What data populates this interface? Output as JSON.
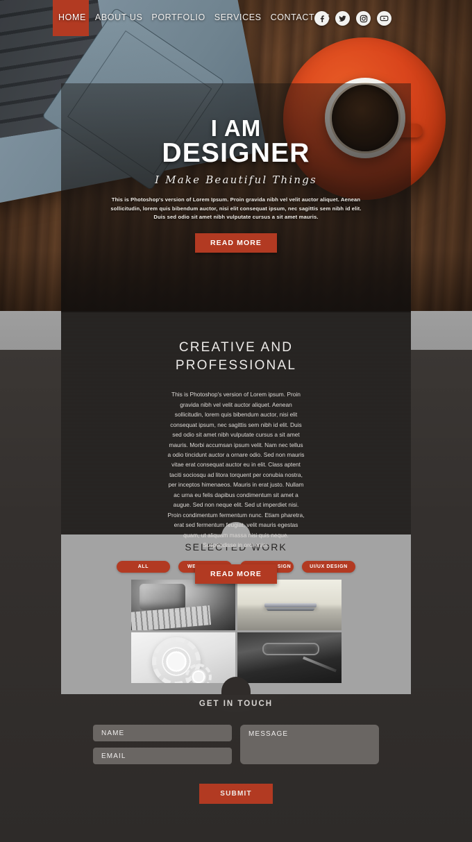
{
  "nav": {
    "items": [
      {
        "label": "HOME",
        "active": true
      },
      {
        "label": "ABOUT US",
        "active": false
      },
      {
        "label": "PORTFOLIO",
        "active": false
      },
      {
        "label": "SERVICES",
        "active": false
      },
      {
        "label": "CONTACT US",
        "active": false
      }
    ],
    "socials": [
      {
        "name": "facebook-icon"
      },
      {
        "name": "twitter-icon"
      },
      {
        "name": "instagram-icon"
      },
      {
        "name": "youtube-icon"
      }
    ]
  },
  "hero": {
    "title_line1": "I AM",
    "title_line2": "DESIGNER",
    "tagline": "I Make Beautiful Things",
    "paragraph": "This is Photoshop's version  of Lorem Ipsum. Proin gravida nibh vel velit auctor aliquet. Aenean sollicitudin, lorem quis bibendum auctor, nisi elit consequat ipsum, nec sagittis sem nibh id elit. Duis sed odio sit amet nibh vulputate cursus a sit amet mauris.",
    "cta": "READ MORE"
  },
  "about": {
    "title_line1": "CREATIVE AND",
    "title_line2": "PROFESSIONAL",
    "paragraph": "This is Photoshop's version  of Lorem ipsum. Proin gravida nibh vel velit auctor aliquet. Aenean sollicitudin, lorem quis bibendum auctor, nisi elit consequat ipsum, nec sagittis sem nibh id elit. Duis sed odio sit amet nibh vulputate cursus a sit amet mauris. Morbi accumsan ipsum velit. Nam nec tellus a odio tincidunt auctor a ornare odio. Sed non  mauris vitae erat consequat auctor eu in elit. Class aptent taciti sociosqu ad litora torquent per conubia nostra, per inceptos himenaeos. Mauris in erat justo. Nullam ac urna eu felis dapibus condimentum sit amet a augue. Sed non neque elit. Sed ut imperdiet nisi. Proin condimentum fermentum nunc. Etiam pharetra, erat sed fermentum feugiat, velit mauris egestas quam, ut aliquam massa nisi quis neque. Suspendisse in orci enim.",
    "cta": "READ MORE"
  },
  "work": {
    "title": "SELECTED WORK",
    "filters": [
      {
        "label": "ALL",
        "active": true
      },
      {
        "label": "WEB DESIGN",
        "active": false
      },
      {
        "label": "GRAPHIC DESIGN",
        "active": false
      },
      {
        "label": "UI/UX DESIGN",
        "active": false
      }
    ],
    "thumbnails": [
      {
        "name": "thumb-keyboard-coffee-mug"
      },
      {
        "name": "thumb-closed-laptop"
      },
      {
        "name": "thumb-gears"
      },
      {
        "name": "thumb-glasses-notebook-pen"
      }
    ]
  },
  "contact": {
    "title": "GET IN TOUCH",
    "name_placeholder": "NAME",
    "email_placeholder": "EMAIL",
    "message_placeholder": "MESSAGE",
    "name_value": "",
    "email_value": "",
    "message_value": "",
    "submit_label": "SUBMIT"
  },
  "colors": {
    "accent_red": "#b23a22",
    "dark_panel": "#262321",
    "gray_panel": "#a3a3a3",
    "page_dark": "#2e2a28"
  }
}
